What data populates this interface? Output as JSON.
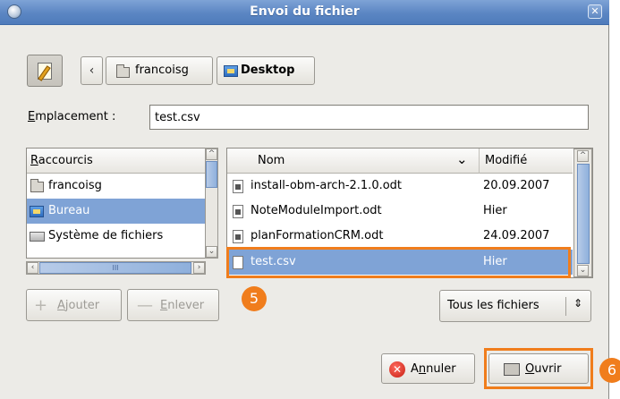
{
  "window": {
    "title": "Envoi du fichier",
    "close_icon": "close-icon"
  },
  "toolbar": {
    "edit_icon": "edit-location-icon",
    "back_arrow": "‹"
  },
  "path": {
    "items": [
      {
        "label": "francoisg",
        "icon": "folder-home-icon"
      },
      {
        "label": "Desktop",
        "icon": "desktop-icon"
      }
    ]
  },
  "location": {
    "label_underlined": "E",
    "label_rest": "mplacement :",
    "value": "test.csv"
  },
  "places": {
    "header_u": "R",
    "header_rest": "accourcis",
    "items": [
      {
        "label": "francoisg",
        "icon": "folder-home-icon",
        "selected": false
      },
      {
        "label": "Bureau",
        "icon": "desktop-icon",
        "selected": true
      },
      {
        "label": "Système de fichiers",
        "icon": "drive-icon",
        "selected": false
      }
    ],
    "hscroll_grip": "III"
  },
  "files": {
    "col_name": "Nom",
    "col_modified": "Modifié",
    "sort_arrow": "⌄",
    "rows": [
      {
        "name": "install-obm-arch-2.1.0.odt",
        "modified": "20.09.2007",
        "selected": false
      },
      {
        "name": "NoteModuleImport.odt",
        "modified": "Hier",
        "selected": false
      },
      {
        "name": "planFormationCRM.odt",
        "modified": "24.09.2007",
        "selected": false
      },
      {
        "name": "test.csv",
        "modified": "Hier",
        "selected": true
      }
    ]
  },
  "buttons": {
    "add_u": "A",
    "add_rest": "jouter",
    "remove_u": "E",
    "remove_rest": "nlever",
    "filter": "Tous les fichiers",
    "cancel_pre": "A",
    "cancel_u": "n",
    "cancel_rest": "nuler",
    "open_u": "O",
    "open_rest": "uvrir"
  },
  "callouts": {
    "step5": "5",
    "step6": "6"
  },
  "colors": {
    "accent": "#f07d1c",
    "selection": "#7fa3d6",
    "titlebar": "#5b86c3"
  }
}
